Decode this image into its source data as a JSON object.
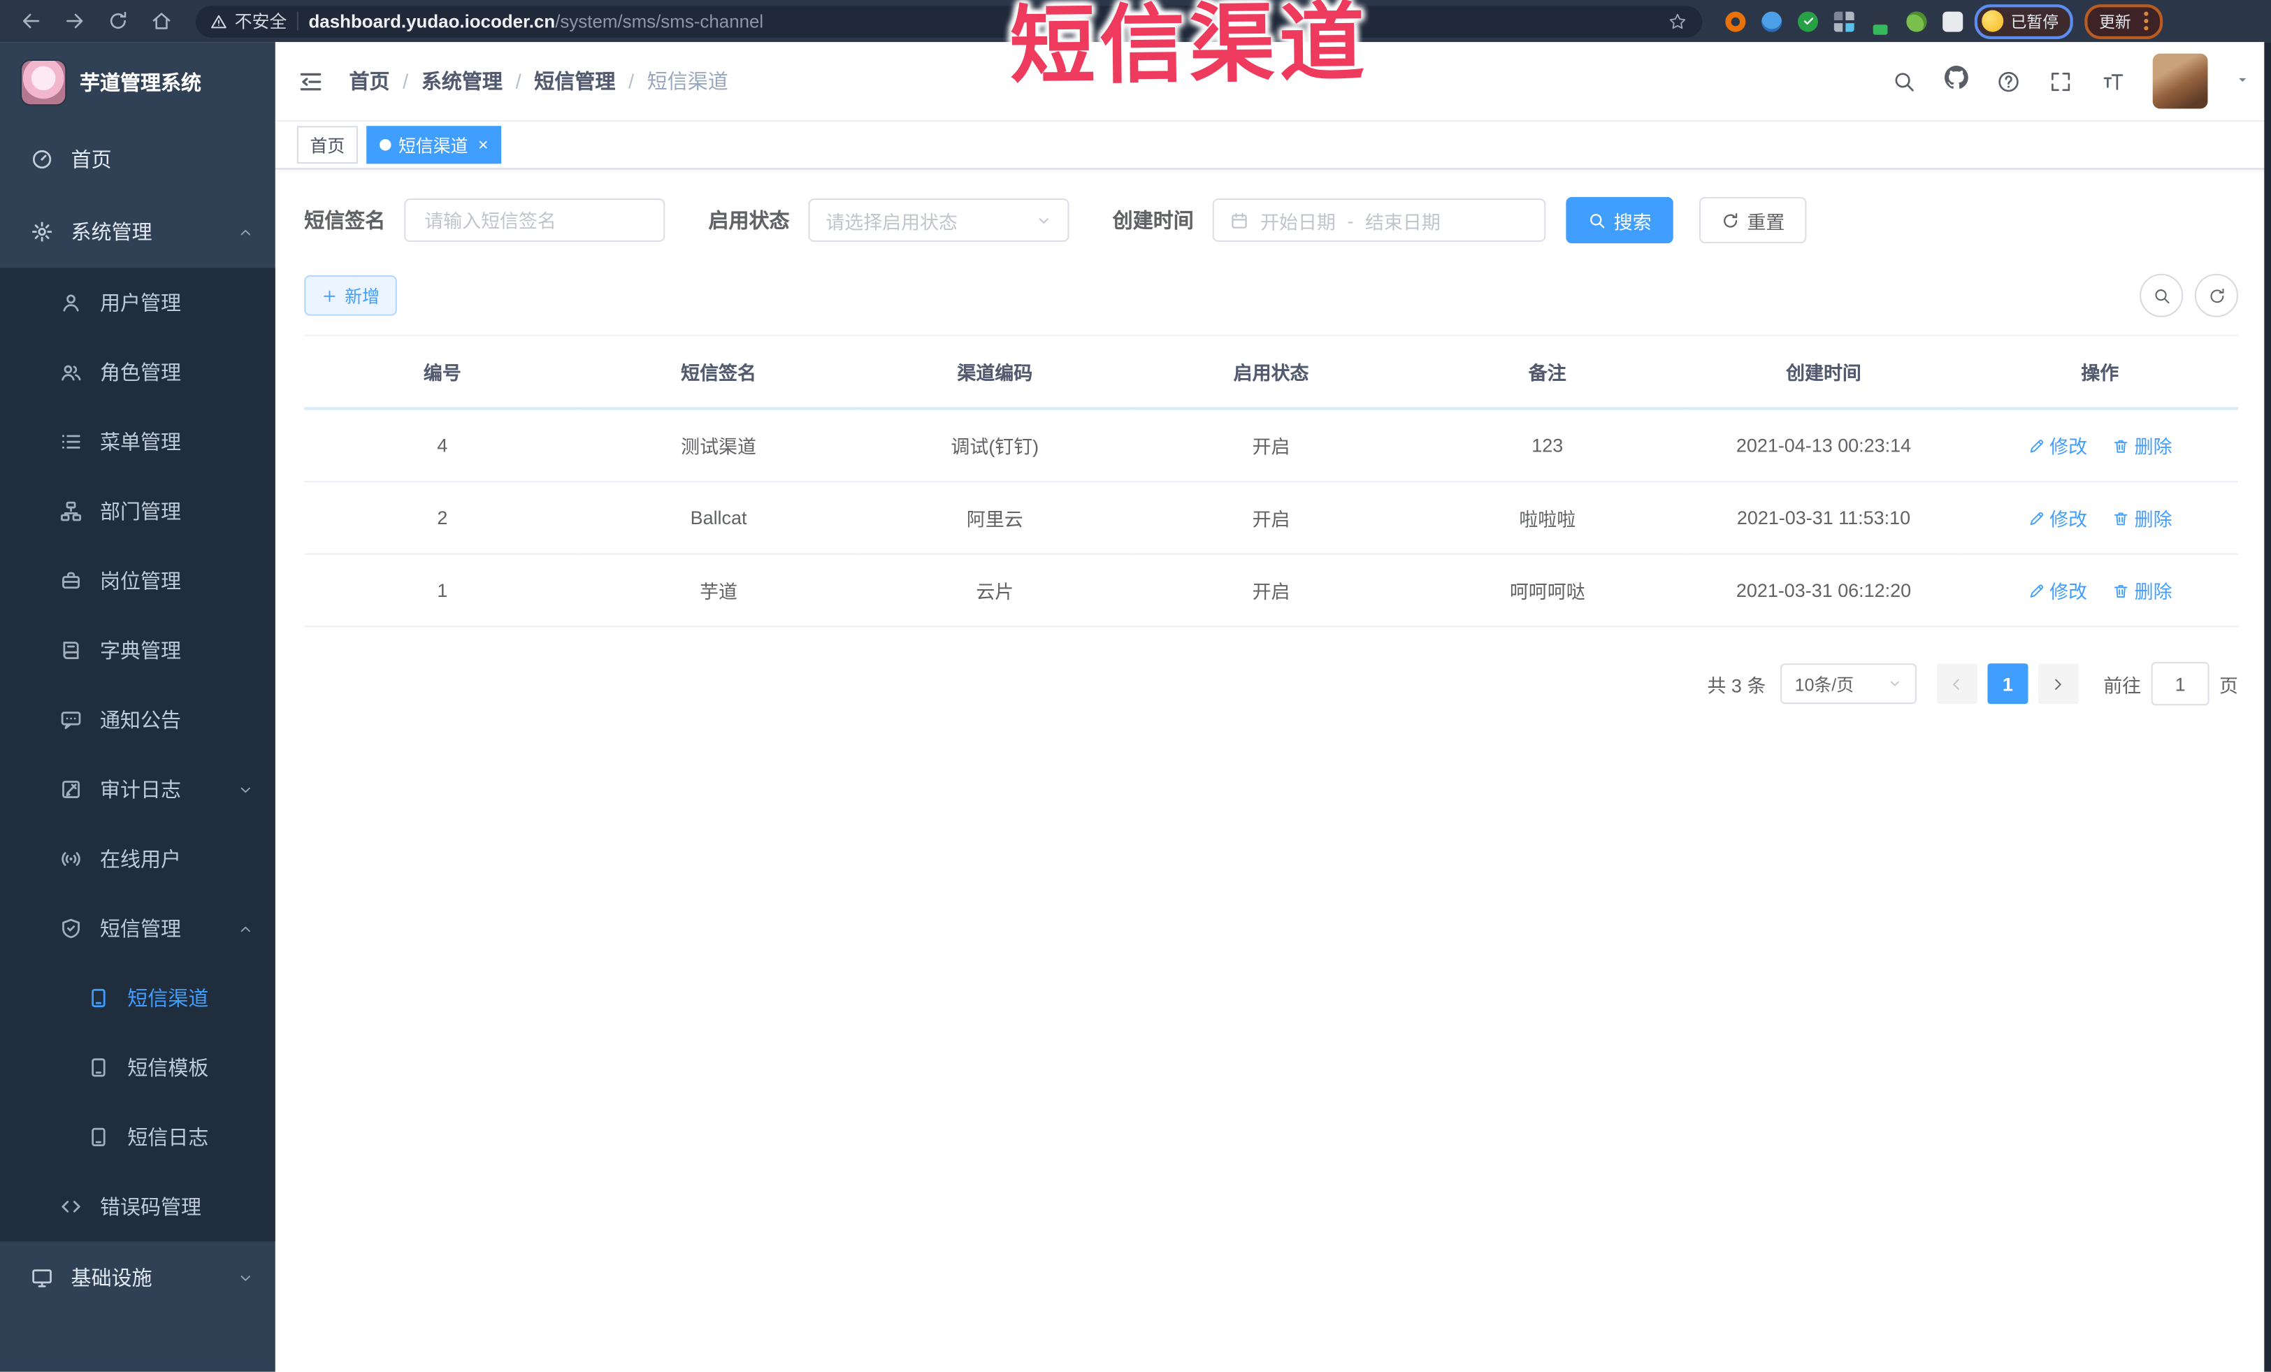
{
  "browser": {
    "security_label": "不安全",
    "url_domain": "dashboard.yudao.iocoder.cn",
    "url_path": "/system/sms/sms-channel",
    "paused_label": "已暂停",
    "update_label": "更新"
  },
  "annotation": {
    "text": "短信渠道",
    "color": "#ee3a5c"
  },
  "sidebar": {
    "logo_title": "芋道管理系统",
    "items": [
      {
        "label": "首页"
      },
      {
        "label": "系统管理"
      },
      {
        "label": "用户管理"
      },
      {
        "label": "角色管理"
      },
      {
        "label": "菜单管理"
      },
      {
        "label": "部门管理"
      },
      {
        "label": "岗位管理"
      },
      {
        "label": "字典管理"
      },
      {
        "label": "通知公告"
      },
      {
        "label": "审计日志"
      },
      {
        "label": "在线用户"
      },
      {
        "label": "短信管理"
      },
      {
        "label": "短信渠道"
      },
      {
        "label": "短信模板"
      },
      {
        "label": "短信日志"
      },
      {
        "label": "错误码管理"
      },
      {
        "label": "基础设施"
      }
    ]
  },
  "header": {
    "breadcrumb": [
      {
        "label": "首页"
      },
      {
        "label": "系统管理"
      },
      {
        "label": "短信管理"
      },
      {
        "label": "短信渠道"
      }
    ]
  },
  "tabs": [
    {
      "label": "首页"
    },
    {
      "label": "短信渠道"
    }
  ],
  "filters": {
    "sign_label": "短信签名",
    "sign_placeholder": "请输入短信签名",
    "status_label": "启用状态",
    "status_placeholder": "请选择启用状态",
    "time_label": "创建时间",
    "start_placeholder": "开始日期",
    "range_separator": "-",
    "end_placeholder": "结束日期",
    "search_label": "搜索",
    "reset_label": "重置"
  },
  "toolbar": {
    "add_label": "新增"
  },
  "table": {
    "columns": [
      "编号",
      "短信签名",
      "渠道编码",
      "启用状态",
      "备注",
      "创建时间",
      "操作"
    ],
    "action_edit": "修改",
    "action_delete": "删除",
    "rows": [
      {
        "id": "4",
        "sign": "测试渠道",
        "code": "调试(钉钉)",
        "status": "开启",
        "remark": "123",
        "created": "2021-04-13 00:23:14"
      },
      {
        "id": "2",
        "sign": "Ballcat",
        "code": "阿里云",
        "status": "开启",
        "remark": "啦啦啦",
        "created": "2021-03-31 11:53:10"
      },
      {
        "id": "1",
        "sign": "芋道",
        "code": "云片",
        "status": "开启",
        "remark": "呵呵呵哒",
        "created": "2021-03-31 06:12:20"
      }
    ]
  },
  "pagination": {
    "total": "共 3 条",
    "page_size": "10条/页",
    "current": "1",
    "goto_label": "前往",
    "goto_value": "1",
    "page_label": "页"
  }
}
